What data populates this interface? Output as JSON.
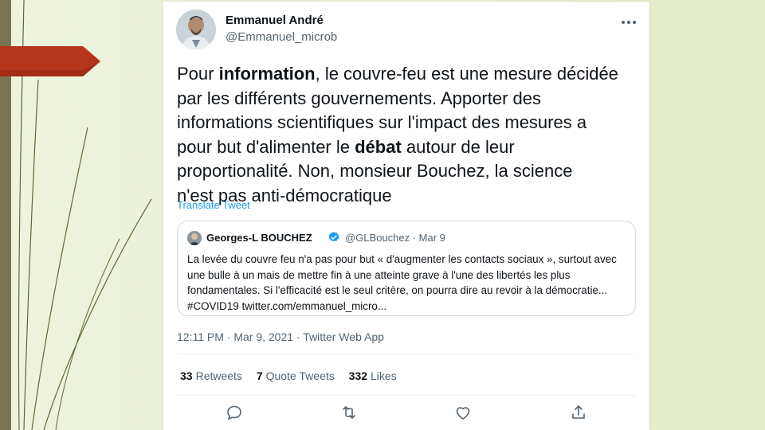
{
  "tweet": {
    "author_name": "Emmanuel André",
    "author_handle": "@Emmanuel_microb",
    "text_segments": [
      {
        "text": "Pour ",
        "bold": false
      },
      {
        "text": "information",
        "bold": true
      },
      {
        "text": ", le couvre-feu est une mesure décidée\npar les différents gouvernements. Apporter des\ninformations scientifiques sur l'impact des mesures a\npour but d'alimenter le ",
        "bold": false
      },
      {
        "text": "débat",
        "bold": true
      },
      {
        "text": " autour de leur\nproportionalité. Non, monsieur Bouchez, la science\nn'est pas anti-démocratique",
        "bold": false
      }
    ],
    "translate_label": "Translate Tweet",
    "timestamp": "12:11 PM · Mar 9, 2021 · Twitter Web App",
    "stats": {
      "retweets_count": "33",
      "retweets_label": "Retweets",
      "quotes_count": "7",
      "quotes_label": "Quote Tweets",
      "likes_count": "332",
      "likes_label": "Likes"
    }
  },
  "quote": {
    "author_name": "Georges-L BOUCHEZ",
    "meta": "@GLBouchez · Mar 9",
    "text": "La levée du couvre feu n'a pas pour but « d'augmenter les contacts sociaux », surtout avec une bulle à un mais de mettre fin à une atteinte grave à l'une des libertés les plus fondamentales. Si l'efficacité est le seul critère, on pourra dire au revoir à la démocratie... #COVID19 twitter.com/emmanuel_micro..."
  },
  "icons": [
    "more-icon",
    "verified-icon",
    "reply-icon",
    "retweet-icon",
    "like-icon",
    "share-icon"
  ],
  "colors": {
    "accent": "#1d9bf0",
    "slide_background": "#eef3dc",
    "side_bar": "#7a7452",
    "red_tab": "#b5341c"
  }
}
